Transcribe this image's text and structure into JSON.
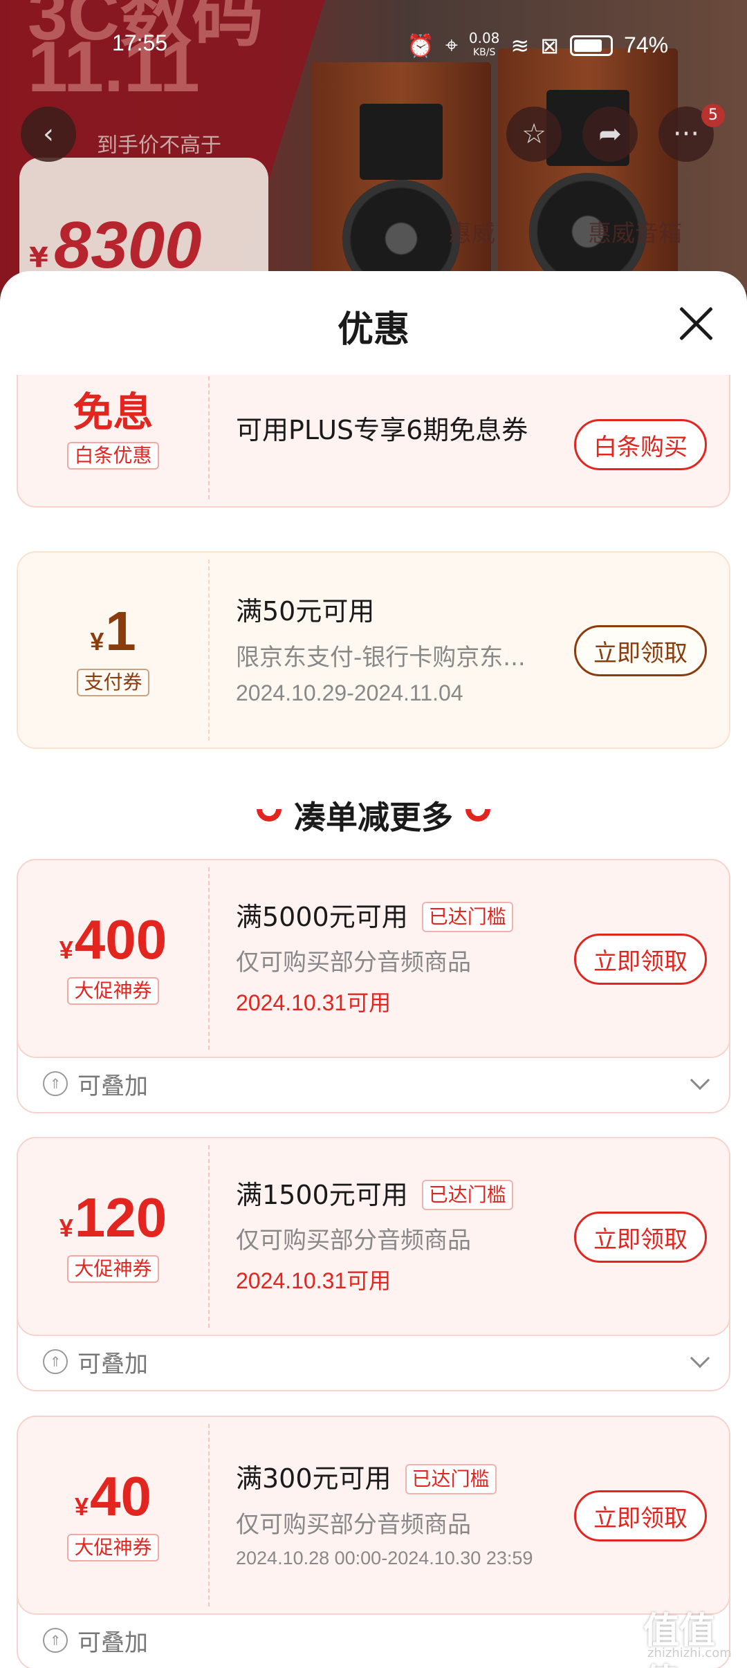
{
  "status_bar": {
    "time": "17:55",
    "net_speed": "0.08",
    "net_unit": "KB/S",
    "battery": "74%"
  },
  "background": {
    "promo_line1": "3C数码",
    "promo_line2": "11.11",
    "price_hint": "到手价不高于",
    "price_yen": "¥",
    "price": "8300",
    "tabs": [
      "惠威",
      "惠威音箱"
    ],
    "cart_badge": "5"
  },
  "sheet": {
    "title": "优惠",
    "section_title": "凑单减更多",
    "coupons": [
      {
        "amount_text": "免息",
        "tag": "白条优惠",
        "condition": "可用PLUS专享6期免息券",
        "button": "白条购买"
      },
      {
        "yen": "¥",
        "amount": "1",
        "tag": "支付券",
        "condition": "满50元可用",
        "desc": "限京东支付-银行卡购京东...",
        "date": "2024.10.29-2024.11.04",
        "button": "立即领取"
      },
      {
        "yen": "¥",
        "amount": "400",
        "tag": "大促神券",
        "condition": "满5000元可用",
        "badge": "已达门槛",
        "desc": "仅可购买部分音频商品",
        "date": "2024.10.31可用",
        "button": "立即领取",
        "stack": "可叠加"
      },
      {
        "yen": "¥",
        "amount": "120",
        "tag": "大促神券",
        "condition": "满1500元可用",
        "badge": "已达门槛",
        "desc": "仅可购买部分音频商品",
        "date": "2024.10.31可用",
        "button": "立即领取",
        "stack": "可叠加"
      },
      {
        "yen": "¥",
        "amount": "40",
        "tag": "大促神券",
        "condition": "满300元可用",
        "badge": "已达门槛",
        "desc": "仅可购买部分音频商品",
        "date": "2024.10.28 00:00-2024.10.30 23:59",
        "button": "立即领取",
        "stack": "可叠加"
      }
    ]
  },
  "watermark": {
    "main": "值值值",
    "sub": "zhizhizhi.com"
  },
  "colors": {
    "accent": "#e2251f",
    "gold": "#8a3c0c",
    "coupon_bg": "#fff3f1"
  }
}
